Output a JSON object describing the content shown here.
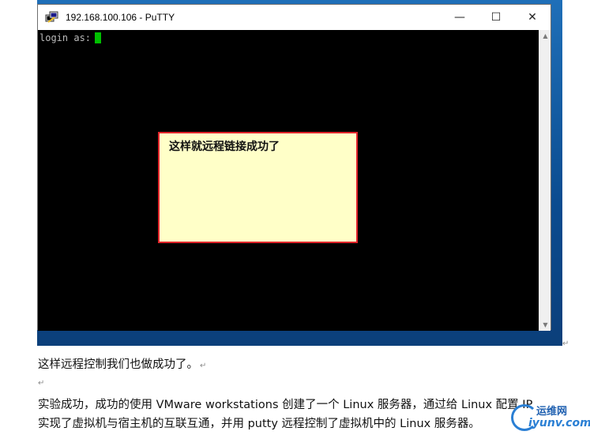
{
  "putty_window": {
    "title": "192.168.100.106 - PuTTY",
    "controls": {
      "minimize": "—",
      "maximize": "☐",
      "close": "✕"
    },
    "terminal": {
      "prompt": "login as:"
    }
  },
  "annotation": {
    "text": "这样就远程链接成功了"
  },
  "document": {
    "line1": "这样远程控制我们也做成功了。",
    "line2": "实验成功，成功的使用 VMware workstations 创建了一个 Linux 服务器，通过给 Linux 配置 IP",
    "line3": "实现了虚拟机与宿主机的互联互通，并用 putty 远程控制了虚拟机中的 Linux 服务器。",
    "paragraph_mark": "↵"
  },
  "watermark": {
    "top": "运维网",
    "bottom": "iyunv.com"
  },
  "colors": {
    "terminal_bg": "#000000",
    "cursor": "#00c000",
    "annotation_bg": "#ffffc8",
    "annotation_border": "#e0242a",
    "desktop": "#0a4b8f"
  }
}
